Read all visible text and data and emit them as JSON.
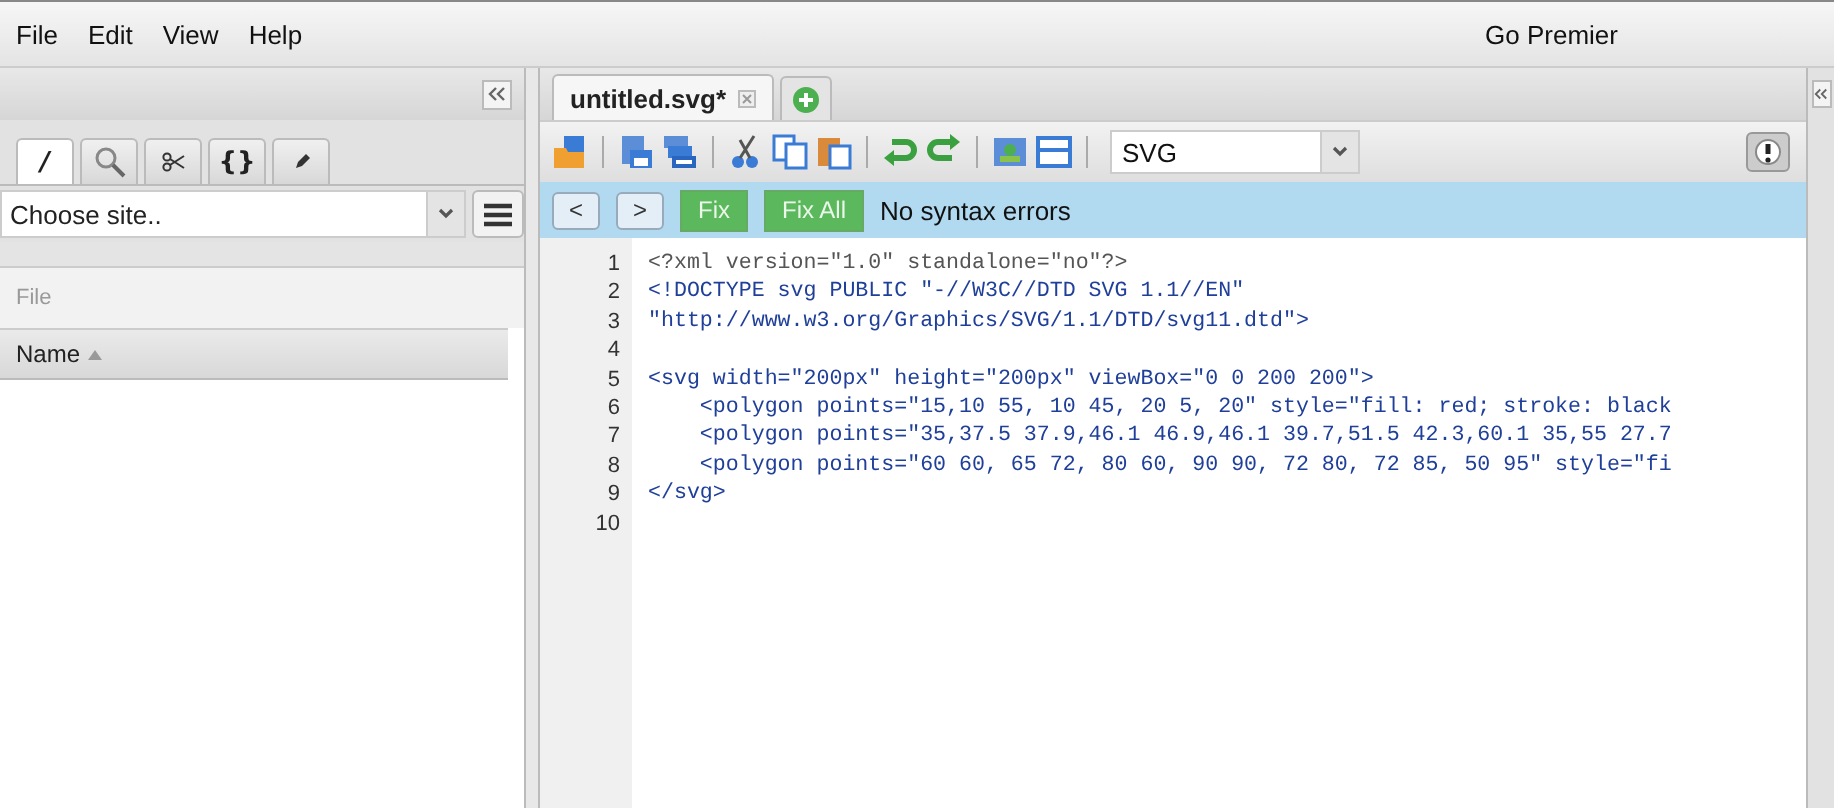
{
  "menu": [
    {
      "label": "File"
    },
    {
      "label": "Edit"
    },
    {
      "label": "View"
    },
    {
      "label": "Help"
    }
  ],
  "account": {
    "label": "Go Premier"
  },
  "sidebar": {
    "tabs": [
      {
        "kind": "slash",
        "label": "/",
        "selected": true
      },
      {
        "kind": "search",
        "selected": false
      },
      {
        "kind": "scissors",
        "selected": false
      },
      {
        "kind": "braces",
        "label": "{}",
        "selected": false
      },
      {
        "kind": "pencil",
        "selected": false
      }
    ],
    "site_select": {
      "value": "Choose site.."
    },
    "section_label": "File",
    "columns": [
      {
        "label": "Name",
        "sort_ascending": true
      }
    ]
  },
  "editor": {
    "tabs": [
      {
        "label": "untitled.svg*",
        "selected": true
      }
    ],
    "mode_select": {
      "value": "SVG"
    },
    "lint_bar": {
      "prev": "<",
      "next": ">",
      "fix": "Fix",
      "fix_all": "Fix All",
      "message": "No syntax errors"
    },
    "lines": [
      {
        "number": "1",
        "kind": "declaration",
        "text": "<?xml version=\"1.0\" standalone=\"no\"?>"
      },
      {
        "number": "2",
        "kind": "markup",
        "text": "<!DOCTYPE svg PUBLIC \"-//W3C//DTD SVG 1.1//EN\""
      },
      {
        "number": "3",
        "kind": "markup",
        "text": "\"http://www.w3.org/Graphics/SVG/1.1/DTD/svg11.dtd\">"
      },
      {
        "number": "4"
      },
      {
        "number": "5",
        "kind": "markup",
        "text": "<svg width=\"200px\" height=\"200px\" viewBox=\"0 0 200 200\">"
      },
      {
        "number": "6",
        "kind": "markup",
        "text": "    <polygon points=\"15,10 55, 10 45, 20 5, 20\" style=\"fill: red; stroke: black"
      },
      {
        "number": "7",
        "kind": "markup",
        "text": "    <polygon points=\"35,37.5 37.9,46.1 46.9,46.1 39.7,51.5 42.3,60.1 35,55 27.7"
      },
      {
        "number": "8",
        "kind": "markup",
        "text": "    <polygon points=\"60 60, 65 72, 80 60, 90 90, 72 80, 72 85, 50 95\" style=\"fi"
      },
      {
        "number": "9",
        "kind": "markup",
        "text": "</svg>"
      },
      {
        "number": "10"
      }
    ]
  }
}
